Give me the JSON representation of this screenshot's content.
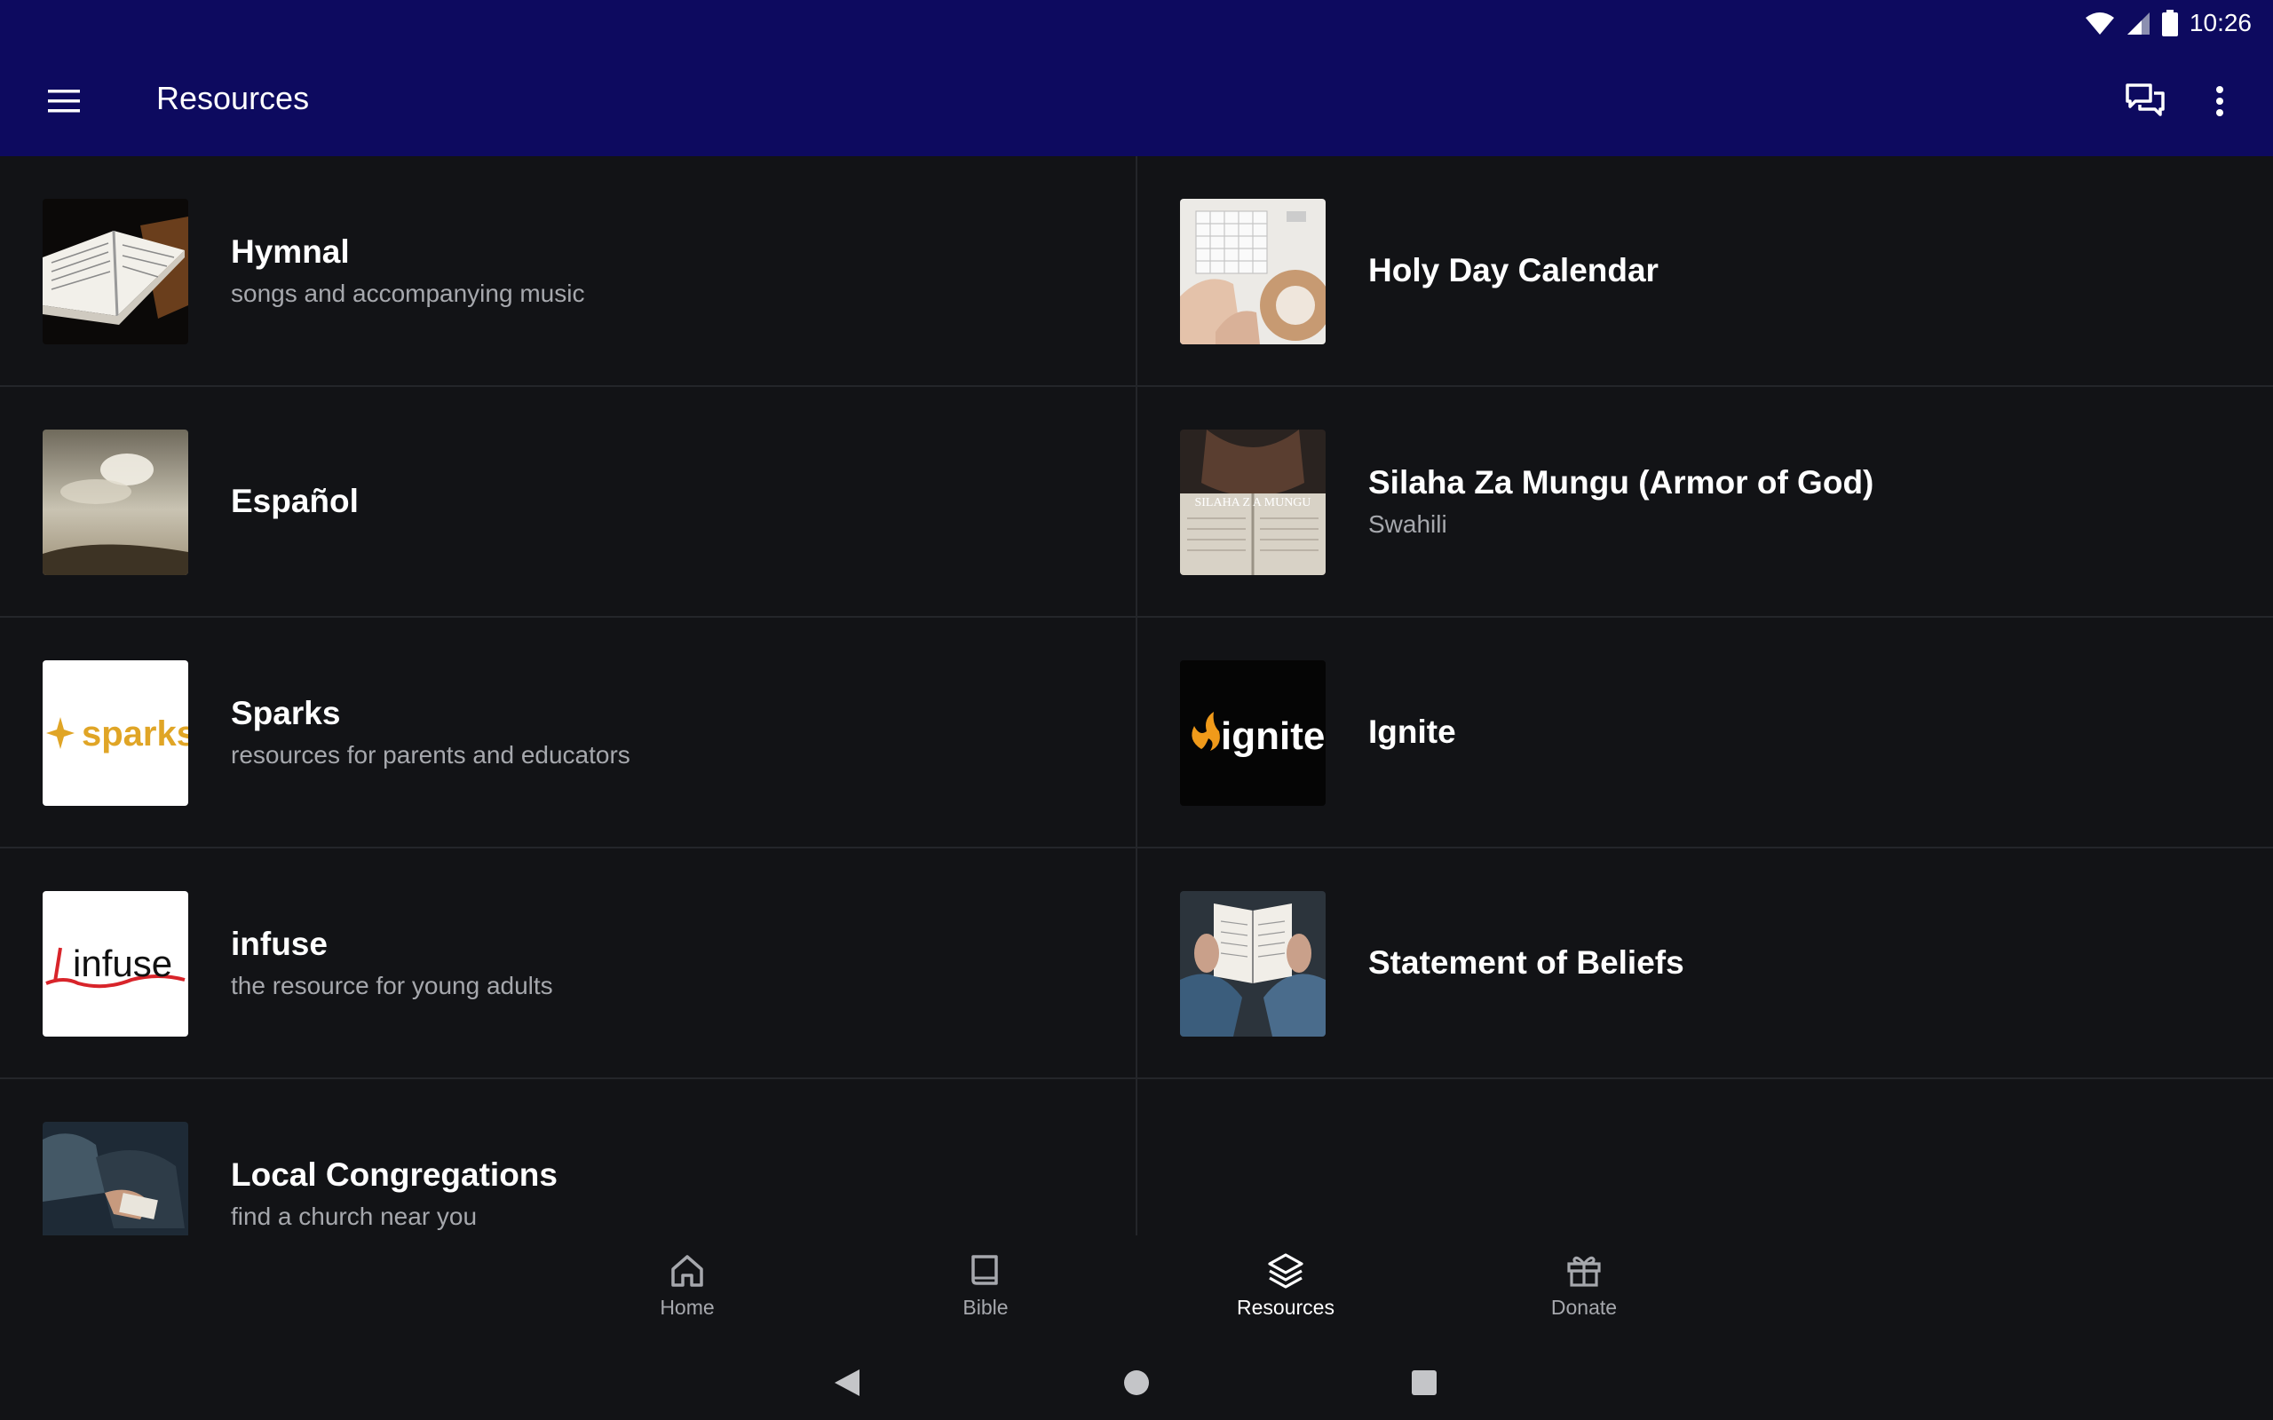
{
  "status": {
    "time": "10:26",
    "icons": [
      "wifi-icon",
      "cell-signal-icon",
      "battery-icon"
    ]
  },
  "appbar": {
    "title": "Resources",
    "icons": [
      "menu-icon",
      "chat-icon",
      "more-vert-icon"
    ],
    "color": "#0d0a5f"
  },
  "resources": [
    {
      "title": "Hymnal",
      "subtitle": "songs and accompanying music"
    },
    {
      "title": "Holy Day Calendar",
      "subtitle": ""
    },
    {
      "title": "Español",
      "subtitle": ""
    },
    {
      "title": "Silaha Za Mungu (Armor of God)",
      "subtitle": "Swahili",
      "thumb_text": "SILAHA Z A MUNGU"
    },
    {
      "title": "Sparks",
      "subtitle": "resources for parents and educators",
      "thumb_text": "sparks"
    },
    {
      "title": "Ignite",
      "subtitle": "",
      "thumb_text": "ignite"
    },
    {
      "title": "infuse",
      "subtitle": "the resource for young adults",
      "thumb_text": "infuse"
    },
    {
      "title": "Statement of Beliefs",
      "subtitle": ""
    },
    {
      "title": "Local Congregations",
      "subtitle": "find a church near you"
    }
  ],
  "bottom_nav": {
    "items": [
      {
        "label": "Home",
        "icon": "home-icon"
      },
      {
        "label": "Bible",
        "icon": "book-icon"
      },
      {
        "label": "Resources",
        "icon": "layers-icon",
        "active": true
      },
      {
        "label": "Donate",
        "icon": "gift-icon"
      }
    ]
  },
  "system_nav": [
    "back-icon",
    "home-circle-icon",
    "recents-icon"
  ]
}
